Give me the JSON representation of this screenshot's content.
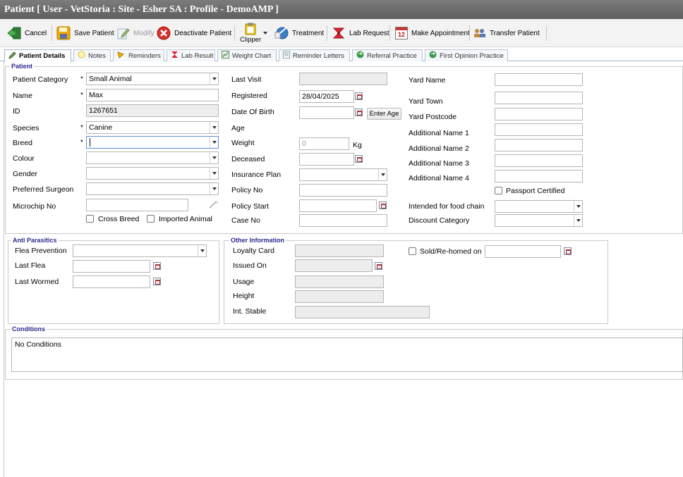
{
  "window": {
    "title": "Patient [ User - VetStoria : Site - Esher SA : Profile - DemoAMP ]"
  },
  "toolbar": {
    "cancel": "Cancel",
    "save_patient": "Save Patient",
    "modify": "Modify",
    "deactivate_patient": "Deactivate Patient",
    "clipper": "Clipper",
    "treatment": "Treatment",
    "lab_request": "Lab Request",
    "make_appointment": "Make Appointment",
    "transfer_patient": "Transfer Patient",
    "calendar_day": "12"
  },
  "tabs": [
    {
      "label": "Patient Details",
      "active": true
    },
    {
      "label": "Notes"
    },
    {
      "label": "Reminders"
    },
    {
      "label": "Lab Result"
    },
    {
      "label": "Weight Chart"
    },
    {
      "label": "Reminder Letters"
    },
    {
      "label": "Referral Practice"
    },
    {
      "label": "First Opinion Practice"
    }
  ],
  "patient": {
    "legend": "Patient",
    "patient_category": {
      "label": "Patient Category",
      "value": "Small Animal"
    },
    "name": {
      "label": "Name",
      "value": "Max"
    },
    "id": {
      "label": "ID",
      "value": "1267651"
    },
    "species": {
      "label": "Species",
      "value": "Canine"
    },
    "breed": {
      "label": "Breed",
      "value": ""
    },
    "colour": {
      "label": "Colour",
      "value": ""
    },
    "gender": {
      "label": "Gender",
      "value": ""
    },
    "preferred_surgeon": {
      "label": "Preferred Surgeon",
      "value": ""
    },
    "microchip_no": {
      "label": "Microchip No",
      "value": ""
    },
    "cross_breed": {
      "label": "Cross Breed",
      "checked": false
    },
    "imported_animal": {
      "label": "Imported Animal",
      "checked": false
    },
    "required_marker": "*",
    "last_visit": {
      "label": "Last Visit",
      "value": ""
    },
    "registered": {
      "label": "Registered",
      "value": "28/04/2025"
    },
    "date_of_birth": {
      "label": "Date Of Birth",
      "value": ""
    },
    "enter_age": "Enter Age",
    "age": {
      "label": "Age"
    },
    "weight": {
      "label": "Weight",
      "value": "0",
      "unit": "Kg"
    },
    "deceased": {
      "label": "Deceased",
      "value": ""
    },
    "insurance_plan": {
      "label": "Insurance Plan",
      "value": ""
    },
    "policy_no": {
      "label": "Policy No",
      "value": ""
    },
    "policy_start": {
      "label": "Policy Start",
      "value": ""
    },
    "case_no": {
      "label": "Case No",
      "value": ""
    },
    "yard_name": {
      "label": "Yard Name",
      "value": ""
    },
    "yard_town": {
      "label": "Yard Town",
      "value": ""
    },
    "yard_postcode": {
      "label": "Yard Postcode",
      "value": ""
    },
    "additional_name_1": {
      "label": "Additional Name 1",
      "value": ""
    },
    "additional_name_2": {
      "label": "Additional Name 2",
      "value": ""
    },
    "additional_name_3": {
      "label": "Additional Name 3",
      "value": ""
    },
    "additional_name_4": {
      "label": "Additional Name 4",
      "value": ""
    },
    "passport_certified": {
      "label": "Passport Certified",
      "checked": false
    },
    "intended_for_food_chain": {
      "label": "Intended for food chain",
      "value": ""
    },
    "discount_category": {
      "label": "Discount Category",
      "value": ""
    }
  },
  "anti_parasitics": {
    "legend": "Anti Parasitics",
    "flea_prevention": {
      "label": "Flea Prevention",
      "value": ""
    },
    "last_flea": {
      "label": "Last Flea",
      "value": ""
    },
    "last_wormed": {
      "label": "Last Wormed",
      "value": ""
    }
  },
  "other_information": {
    "legend": "Other Information",
    "loyalty_card": {
      "label": "Loyalty Card",
      "value": ""
    },
    "issued_on": {
      "label": "Issued On",
      "value": ""
    },
    "usage": {
      "label": "Usage",
      "value": ""
    },
    "height": {
      "label": "Height",
      "value": ""
    },
    "int_stable": {
      "label": "Int. Stable",
      "value": ""
    },
    "sold_rehomed_on": {
      "label": "Sold/Re-homed on",
      "checked": false,
      "value": ""
    }
  },
  "conditions": {
    "legend": "Conditions",
    "text": "No Conditions"
  }
}
